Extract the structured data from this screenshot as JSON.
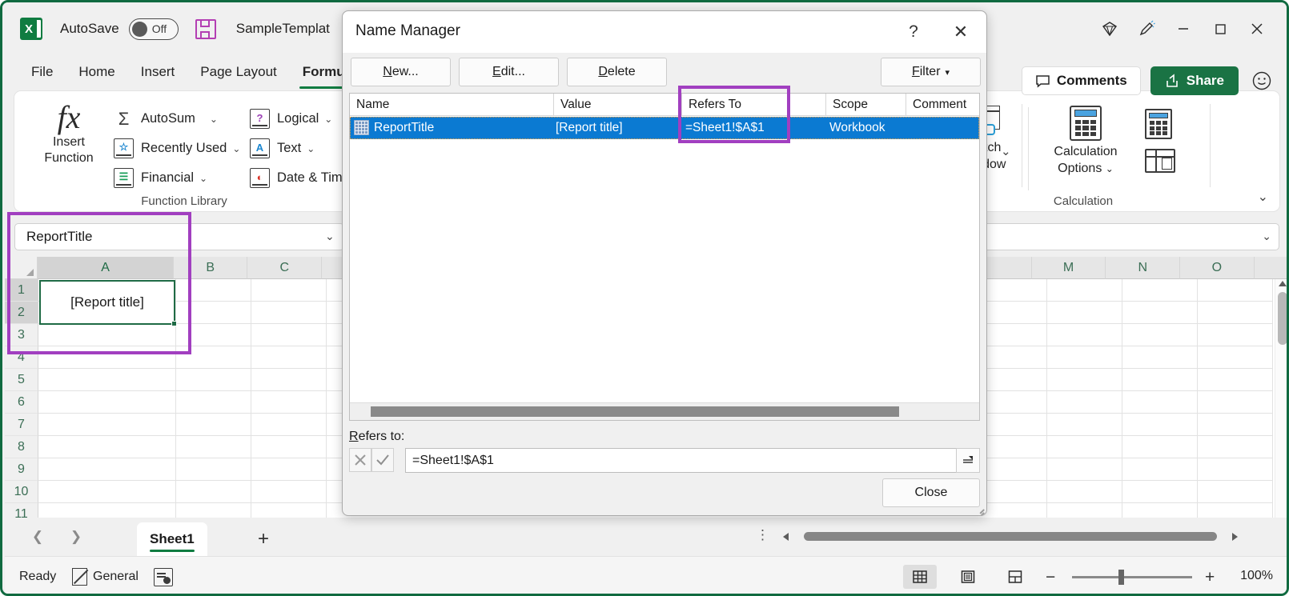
{
  "app": {
    "autosave_label": "AutoSave",
    "autosave_state": "Off",
    "document_title": "SampleTemplat",
    "save_icon": "save-icon",
    "logo_letter": "X"
  },
  "titlebar_right": {
    "diamond_icon": "diamond-icon",
    "pen_icon": "draw-pen-icon",
    "minimize": "minimize-icon",
    "maximize": "maximize-icon",
    "close": "close-icon"
  },
  "ribbon_tabs": [
    {
      "label": "File",
      "active": false
    },
    {
      "label": "Home",
      "active": false
    },
    {
      "label": "Insert",
      "active": false
    },
    {
      "label": "Page Layout",
      "active": false
    },
    {
      "label": "Formulas",
      "active": true
    }
  ],
  "ribbon": {
    "insert_function": {
      "line1": "Insert",
      "line2": "Function",
      "glyph": "fx"
    },
    "function_items": [
      {
        "label": "AutoSum",
        "icon": "sigma-icon",
        "glyph": "Σ",
        "color": "#3c3c3c",
        "chevron": true
      },
      {
        "label": "Recently Used",
        "icon": "star-book-icon",
        "glyph": "☆",
        "color": "#1a86d0",
        "chevron": true
      },
      {
        "label": "Financial",
        "icon": "financial-book-icon",
        "glyph": "≡",
        "color": "#1a9e5a",
        "chevron": true
      },
      {
        "label": "Logical",
        "icon": "logical-book-icon",
        "glyph": "?",
        "color": "#9b3fb5",
        "chevron": true
      },
      {
        "label": "Text",
        "icon": "text-book-icon",
        "glyph": "A",
        "color": "#1a86d0",
        "chevron": true
      },
      {
        "label": "Date & Time",
        "icon": "clock-book-icon",
        "glyph": "◔",
        "color": "#d93025",
        "chevron": true
      }
    ],
    "function_library_group": "Function Library",
    "watch_window": {
      "line1": "Watch",
      "line2": "Window"
    },
    "calculation_options": {
      "line1": "Calculation",
      "line2": "Options"
    },
    "calculation_group": "Calculation",
    "calc_now_icon": "calculate-now-icon",
    "calc_sheet_icon": "calculate-sheet-icon",
    "expand_icon": "chevron-down-icon"
  },
  "formula_bar": {
    "name_box_value": "ReportTitle",
    "formula_value": "",
    "name_box_chevron": "chevron-down-icon",
    "formula_chevron": "chevron-down-icon"
  },
  "grid": {
    "columns": [
      "A",
      "B",
      "C",
      "M",
      "N",
      "O"
    ],
    "rows": [
      "1",
      "2",
      "3",
      "4",
      "5",
      "6",
      "7",
      "8",
      "9",
      "10",
      "11"
    ],
    "selected_cell_value": "[Report title]",
    "selected_column": "A",
    "selected_rows": [
      "1",
      "2"
    ]
  },
  "sheet_tabs": {
    "prev_icon": "chevron-left-icon",
    "next_icon": "chevron-right-icon",
    "tabs": [
      {
        "label": "Sheet1",
        "active": true
      }
    ],
    "add_sheet_icon": "plus-icon",
    "overflow_icon": "vertical-dots-icon"
  },
  "status_bar": {
    "state": "Ready",
    "number_format": "General",
    "accessibility_icon": "accessibility-check-icon",
    "views": [
      {
        "name": "normal-view",
        "icon": "grid-view-icon",
        "active": true
      },
      {
        "name": "page-layout-view",
        "icon": "page-layout-icon",
        "active": false
      },
      {
        "name": "page-break-view",
        "icon": "page-break-icon",
        "active": false
      }
    ],
    "zoom_out": "−",
    "zoom_in": "+",
    "zoom_level": "100%"
  },
  "top_right_actions": {
    "comments_label": "Comments",
    "comments_icon": "comment-bubble-icon",
    "share_label": "Share",
    "share_icon": "share-icon",
    "emoji_icon": "smiley-feedback-icon"
  },
  "dialog": {
    "title": "Name Manager",
    "help_glyph": "?",
    "close_glyph": "✕",
    "buttons": {
      "new": {
        "pre": "",
        "accel": "N",
        "post": "ew..."
      },
      "edit": {
        "pre": "",
        "accel": "E",
        "post": "dit..."
      },
      "delete": {
        "pre": "",
        "accel": "D",
        "post": "elete"
      },
      "filter": {
        "pre": "",
        "accel": "F",
        "post": "ilter",
        "caret": "▾"
      },
      "close": "Close"
    },
    "list_headers": [
      "Name",
      "Value",
      "Refers To",
      "Scope",
      "Comment"
    ],
    "rows": [
      {
        "name": "ReportTitle",
        "value": "[Report title]",
        "refers_to": "=Sheet1!$A$1",
        "scope": "Workbook",
        "comment": "",
        "selected": true,
        "icon": "name-range-icon"
      }
    ],
    "refers_to_label": {
      "accel": "R",
      "post": "efers to:"
    },
    "refers_to_value": "=Sheet1!$A$1",
    "cancel_edit_icon": "cancel-x-icon",
    "confirm_edit_icon": "confirm-check-icon",
    "collapse_dialog_icon": "collapse-range-icon"
  },
  "annotations": {
    "color": "#a13fc0",
    "boxes": [
      {
        "name": "refers-to-column-highlight"
      },
      {
        "name": "name-box-cell-highlight"
      }
    ]
  }
}
